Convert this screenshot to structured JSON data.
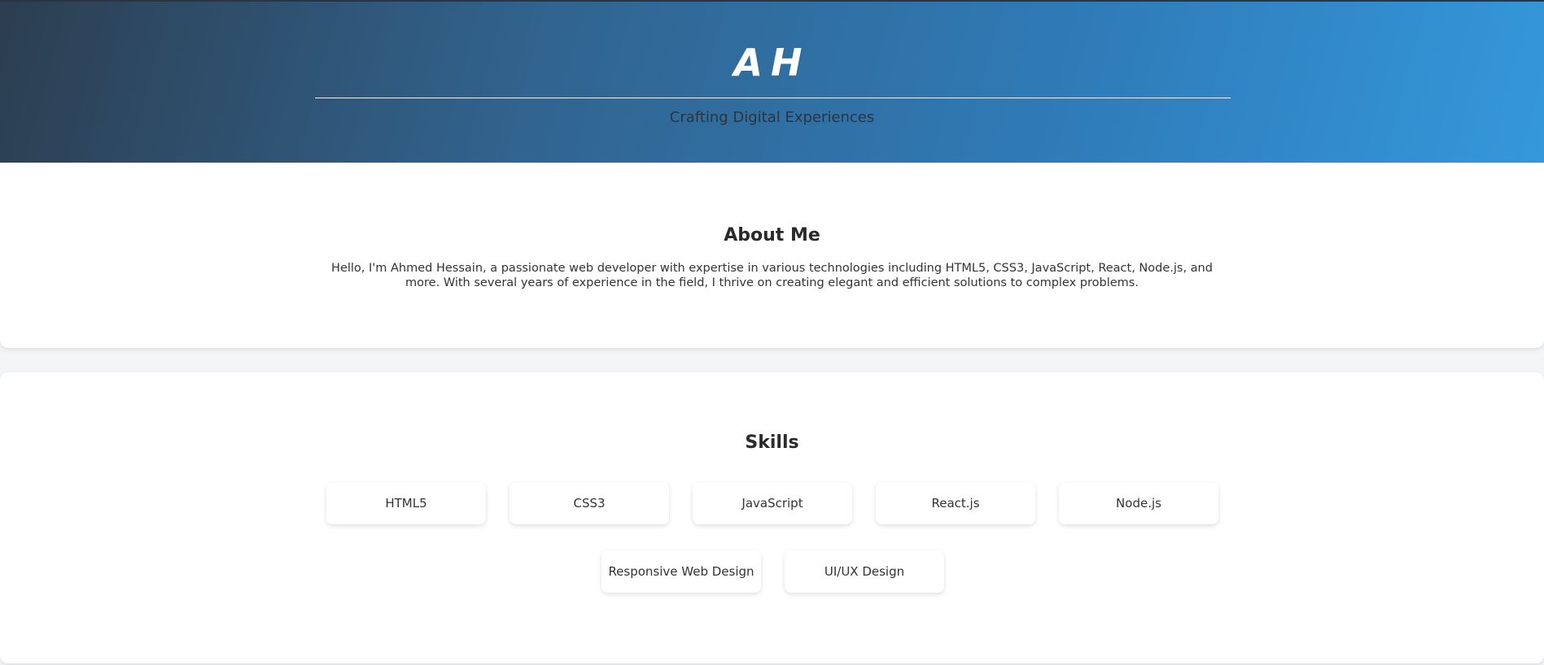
{
  "header": {
    "logo": "AH",
    "tagline": "Crafting Digital Experiences"
  },
  "about": {
    "title": "About Me",
    "text": "Hello, I'm Ahmed Hessain, a passionate web developer with expertise in various technologies including HTML5, CSS3, JavaScript, React, Node.js, and more. With several years of experience in the field, I thrive on creating elegant and efficient solutions to complex problems."
  },
  "skills": {
    "title": "Skills",
    "items": [
      {
        "label": "HTML5"
      },
      {
        "label": "CSS3"
      },
      {
        "label": "JavaScript"
      },
      {
        "label": "React.js"
      },
      {
        "label": "Node.js"
      },
      {
        "label": "Responsive Web Design"
      },
      {
        "label": "UI/UX Design"
      }
    ]
  },
  "colors": {
    "header_gradient_start": "#2c3e50",
    "header_gradient_end": "#3498db",
    "page_background": "#f4f5f7",
    "card_background": "#ffffff"
  }
}
